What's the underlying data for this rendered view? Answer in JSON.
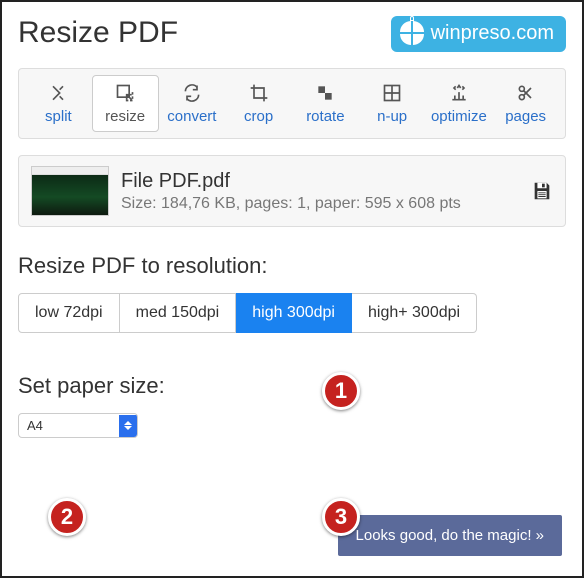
{
  "header": {
    "title": "Resize PDF",
    "brand": "winpreso.com"
  },
  "toolbar": [
    {
      "id": "split",
      "label": "split",
      "active": false
    },
    {
      "id": "resize",
      "label": "resize",
      "active": true
    },
    {
      "id": "convert",
      "label": "convert",
      "active": false
    },
    {
      "id": "crop",
      "label": "crop",
      "active": false
    },
    {
      "id": "rotate",
      "label": "rotate",
      "active": false
    },
    {
      "id": "nup",
      "label": "n-up",
      "active": false
    },
    {
      "id": "optimize",
      "label": "optimize",
      "active": false
    },
    {
      "id": "pages",
      "label": "pages",
      "active": false
    }
  ],
  "file": {
    "name": "File PDF.pdf",
    "meta": "Size: 184,76 KB, pages: 1, paper: 595 x 608 pts"
  },
  "resolution": {
    "label": "Resize PDF to resolution:",
    "options": [
      {
        "id": "low",
        "label": "low 72dpi",
        "selected": false
      },
      {
        "id": "med",
        "label": "med 150dpi",
        "selected": false
      },
      {
        "id": "high",
        "label": "high 300dpi",
        "selected": true
      },
      {
        "id": "highplus",
        "label": "high+ 300dpi",
        "selected": false
      }
    ]
  },
  "paper": {
    "label": "Set paper size:",
    "selected": "A4"
  },
  "cta": {
    "label": "Looks good, do the magic! »"
  },
  "callouts": {
    "c1": "1",
    "c2": "2",
    "c3": "3"
  }
}
